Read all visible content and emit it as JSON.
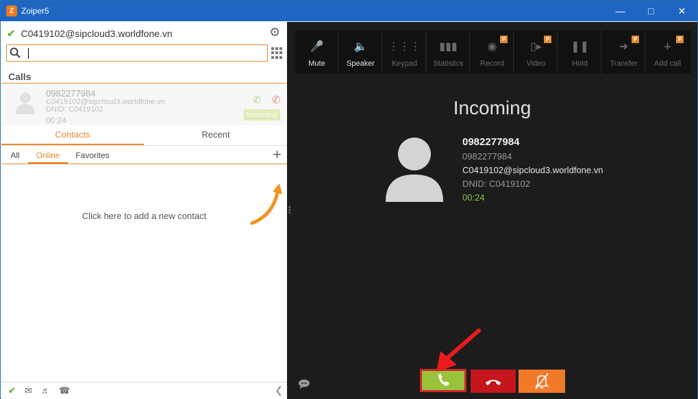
{
  "window": {
    "title": "Zoiper5",
    "app_icon_letter": "Z"
  },
  "account": {
    "name": "C0419102@sipcloud3.worldfone.vn",
    "status_icon": "check-icon"
  },
  "search": {
    "placeholder": "",
    "value": ""
  },
  "calls": {
    "title": "Calls",
    "item": {
      "number": "0982277984",
      "account": "C0419102@sipcloud3.worldfone.vn",
      "dnid": "DNID: C0419102",
      "duration": "00:24",
      "badge": "Incoming"
    }
  },
  "tabs": [
    {
      "label": "Contacts",
      "active": true
    },
    {
      "label": "Recent",
      "active": false
    }
  ],
  "subtabs": [
    {
      "label": "All"
    },
    {
      "label": "Online",
      "active": true
    },
    {
      "label": "Favorites"
    }
  ],
  "empty_contacts": "Click here to add a new contact",
  "toolbar": [
    {
      "label": "Mute",
      "icon": "mic-off-icon",
      "enabled": true
    },
    {
      "label": "Speaker",
      "icon": "speaker-icon",
      "enabled": true
    },
    {
      "label": "Keypad",
      "icon": "keypad-icon",
      "enabled": false
    },
    {
      "label": "Statistics",
      "icon": "stats-icon",
      "enabled": false
    },
    {
      "label": "Record",
      "icon": "record-icon",
      "enabled": false,
      "premium": true
    },
    {
      "label": "Video",
      "icon": "video-icon",
      "enabled": false,
      "premium": true
    },
    {
      "label": "Hold",
      "icon": "pause-icon",
      "enabled": false
    },
    {
      "label": "Transfer",
      "icon": "transfer-icon",
      "enabled": false,
      "premium": true
    },
    {
      "label": "Add call",
      "icon": "plus-icon",
      "enabled": false,
      "premium": true
    }
  ],
  "premium_badge": "P",
  "call_view": {
    "state": "Incoming",
    "name": "0982277984",
    "number": "0982277984",
    "account": "C0419102@sipcloud3.worldfone.vn",
    "dnid": "DNID: C0419102",
    "duration": "00:24"
  },
  "colors": {
    "accent": "#e8892f",
    "answer": "#9ac33c",
    "hangup": "#c4161c",
    "silence": "#f07a2a",
    "titlebar": "#1f66c2"
  }
}
